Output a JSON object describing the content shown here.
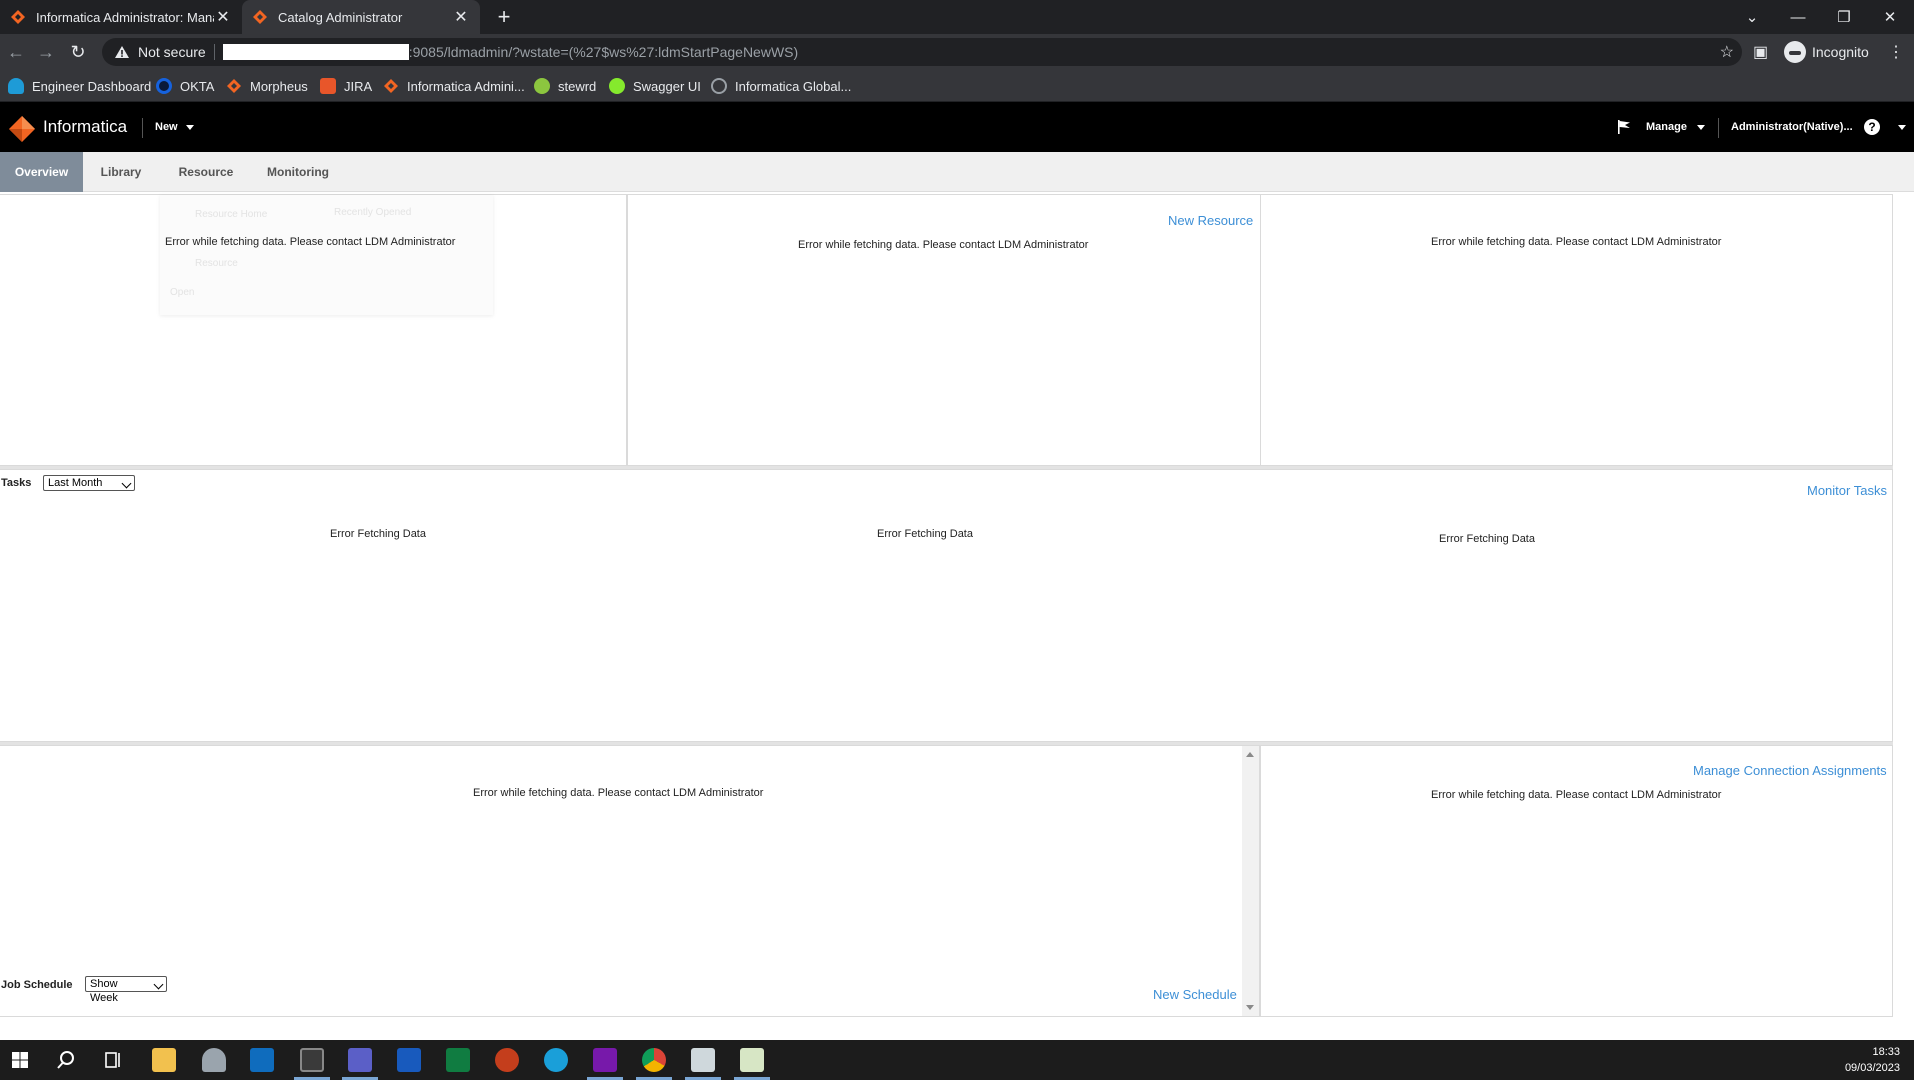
{
  "browser": {
    "tabs": [
      {
        "title": "Informatica Administrator: Mana",
        "active": false
      },
      {
        "title": "Catalog Administrator",
        "active": true
      }
    ],
    "address": {
      "security_label": "Not secure",
      "url_visible": ":9085/ldmadmin/?wstate=(%27$ws%27:ldmStartPageNewWS)"
    },
    "profile_label": "Incognito",
    "bookmarks": [
      {
        "label": "Engineer Dashboard",
        "icon": "cloud-icon",
        "color": "#1e9bd7"
      },
      {
        "label": "OKTA",
        "icon": "okta-icon",
        "color": "#1662dd"
      },
      {
        "label": "Morpheus",
        "icon": "informatica-diamond-icon",
        "color": "#f26522"
      },
      {
        "label": "JIRA",
        "icon": "jira-icon",
        "color": "#e8562a"
      },
      {
        "label": "Informatica Admini...",
        "icon": "informatica-diamond-icon",
        "color": "#f26522"
      },
      {
        "label": "stewrd",
        "icon": "globe-icon",
        "color": "#8cc63f"
      },
      {
        "label": "Swagger UI",
        "icon": "swagger-icon",
        "color": "#85ea2d"
      },
      {
        "label": "Informatica Global...",
        "icon": "globe-icon",
        "color": "#9aa0a6"
      }
    ]
  },
  "app": {
    "brand": "Informatica",
    "brand_color": "#f26522",
    "new_menu": "New",
    "manage_menu": "Manage",
    "user_menu": "Administrator(Native)...",
    "help": "?",
    "nav_tabs": [
      "Overview",
      "Library",
      "Resource",
      "Monitoring"
    ],
    "active_tab": "Overview",
    "ghost_labels": {
      "resource_home": "Resource Home",
      "recently_opened": "Recently Opened",
      "resource": "Resource",
      "open": "Open"
    },
    "panels": {
      "resources_error": "Error while fetching data. Please contact LDM Administrator",
      "new_resource_link": "New Resource",
      "resource_summary_error": "Error while fetching data. Please contact LDM Administrator",
      "top_right_error": "Error while fetching data. Please contact LDM Administrator",
      "tasks_label": "Tasks",
      "tasks_filter": "Last Month",
      "monitor_tasks_link": "Monitor Tasks",
      "tasks_errors": [
        "Error Fetching Data",
        "Error Fetching Data",
        "Error Fetching Data"
      ],
      "schedule_error": "Error while fetching data. Please contact LDM Administrator",
      "job_schedule_label": "Job Schedule",
      "job_schedule_filter": "Show Week",
      "new_schedule_link": "New Schedule",
      "manage_conn_link": "Manage Connection Assignments",
      "connections_error": "Error while fetching data. Please contact LDM Administrator"
    },
    "link_color": "#3d8fd6"
  },
  "taskbar": {
    "time": "18:33",
    "date": "09/03/2023"
  }
}
